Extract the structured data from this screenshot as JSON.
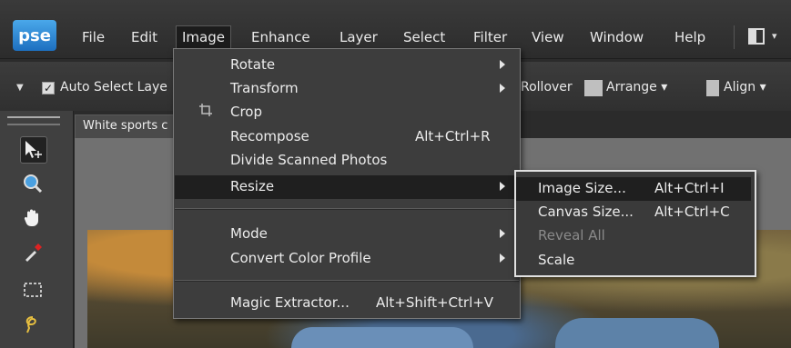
{
  "app": {
    "logo": "pse"
  },
  "menubar": {
    "items": [
      "File",
      "Edit",
      "Image",
      "Enhance",
      "Layer",
      "Select",
      "Filter",
      "View",
      "Window",
      "Help"
    ],
    "active": "Image",
    "panel_icon": "panel-layout-icon"
  },
  "options_bar": {
    "auto_select": {
      "label": "Auto Select Laye",
      "checked": true
    },
    "rollover": "Rollover",
    "arrange": "Arrange ▾",
    "align": "Align ▾"
  },
  "document": {
    "tab_title": "White sports c"
  },
  "toolbox": {
    "tools": [
      "move-tool-icon",
      "zoom-tool-icon",
      "hand-tool-icon",
      "eyedropper-tool-icon",
      "marquee-tool-icon",
      "lasso-tool-icon"
    ]
  },
  "image_menu": {
    "items": [
      {
        "label": "Rotate",
        "shortcut": "",
        "submenu": true
      },
      {
        "label": "Transform",
        "shortcut": "",
        "submenu": true
      },
      {
        "label": "Crop",
        "shortcut": "",
        "submenu": false,
        "icon": "crop-icon"
      },
      {
        "label": "Recompose",
        "shortcut": "Alt+Ctrl+R",
        "submenu": false
      },
      {
        "label": "Divide Scanned Photos",
        "shortcut": "",
        "submenu": false
      },
      {
        "label": "Resize",
        "shortcut": "",
        "submenu": true,
        "highlighted": true
      },
      {
        "label": "Mode",
        "shortcut": "",
        "submenu": true
      },
      {
        "label": "Convert Color Profile",
        "shortcut": "",
        "submenu": true
      },
      {
        "label": "Magic Extractor...",
        "shortcut": "Alt+Shift+Ctrl+V",
        "submenu": false
      }
    ]
  },
  "resize_submenu": {
    "items": [
      {
        "label": "Image Size...",
        "shortcut": "Alt+Ctrl+I",
        "highlighted": true,
        "enabled": true
      },
      {
        "label": "Canvas Size...",
        "shortcut": "Alt+Ctrl+C",
        "enabled": true
      },
      {
        "label": "Reveal All",
        "shortcut": "",
        "enabled": false
      },
      {
        "label": "Scale",
        "shortcut": "",
        "enabled": true
      }
    ]
  }
}
